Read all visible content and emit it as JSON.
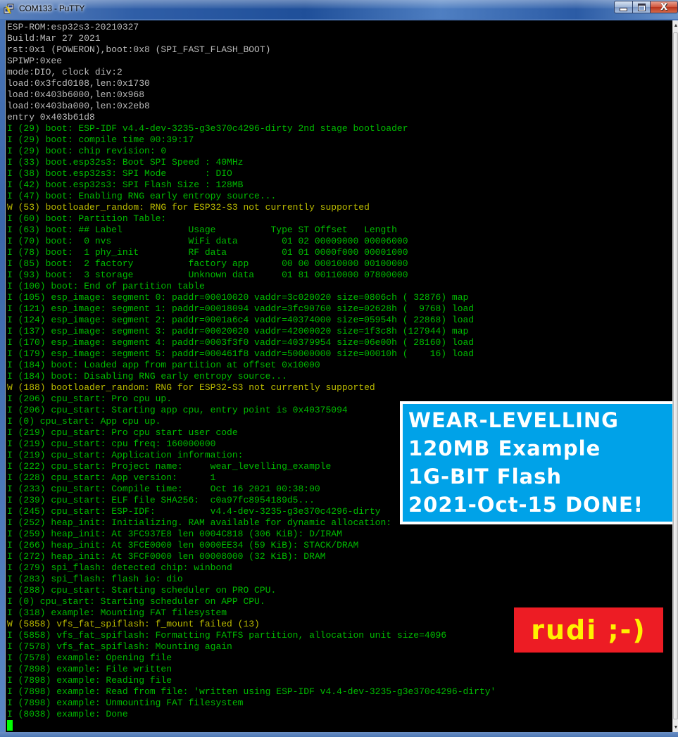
{
  "window": {
    "title": "COM133 - PuTTY",
    "app_icon": "putty-icon",
    "controls": {
      "minimize": "minimize-icon",
      "maximize": "maximize-icon",
      "close": "close-icon",
      "close_glyph": "X"
    }
  },
  "colors": {
    "terminal_bg": "#000000",
    "rom_text": "#bbbbbb",
    "info_text": "#00bb00",
    "warn_text": "#bbbb00",
    "cursor": "#00ff00",
    "banner_bg": "#00a2e8",
    "banner_border": "#ffffff",
    "signature_bg": "#ed1c24",
    "signature_text": "#fff200"
  },
  "terminal": {
    "lines": [
      {
        "level": "plain",
        "text": "ESP-ROM:esp32s3-20210327"
      },
      {
        "level": "plain",
        "text": "Build:Mar 27 2021"
      },
      {
        "level": "plain",
        "text": "rst:0x1 (POWERON),boot:0x8 (SPI_FAST_FLASH_BOOT)"
      },
      {
        "level": "plain",
        "text": "SPIWP:0xee"
      },
      {
        "level": "plain",
        "text": "mode:DIO, clock div:2"
      },
      {
        "level": "plain",
        "text": "load:0x3fcd0108,len:0x1730"
      },
      {
        "level": "plain",
        "text": "load:0x403b6000,len:0x968"
      },
      {
        "level": "plain",
        "text": "load:0x403ba000,len:0x2eb8"
      },
      {
        "level": "plain",
        "text": "entry 0x403b61d8"
      },
      {
        "level": "I",
        "text": "I (29) boot: ESP-IDF v4.4-dev-3235-g3e370c4296-dirty 2nd stage bootloader"
      },
      {
        "level": "I",
        "text": "I (29) boot: compile time 00:39:17"
      },
      {
        "level": "I",
        "text": "I (29) boot: chip revision: 0"
      },
      {
        "level": "I",
        "text": "I (33) boot.esp32s3: Boot SPI Speed : 40MHz"
      },
      {
        "level": "I",
        "text": "I (38) boot.esp32s3: SPI Mode       : DIO"
      },
      {
        "level": "I",
        "text": "I (42) boot.esp32s3: SPI Flash Size : 128MB"
      },
      {
        "level": "I",
        "text": "I (47) boot: Enabling RNG early entropy source..."
      },
      {
        "level": "W",
        "text": "W (53) bootloader_random: RNG for ESP32-S3 not currently supported"
      },
      {
        "level": "I",
        "text": "I (60) boot: Partition Table:"
      },
      {
        "level": "I",
        "text": "I (63) boot: ## Label            Usage          Type ST Offset   Length"
      },
      {
        "level": "I",
        "text": "I (70) boot:  0 nvs              WiFi data        01 02 00009000 00006000"
      },
      {
        "level": "I",
        "text": "I (78) boot:  1 phy_init         RF data          01 01 0000f000 00001000"
      },
      {
        "level": "I",
        "text": "I (85) boot:  2 factory          factory app      00 00 00010000 00100000"
      },
      {
        "level": "I",
        "text": "I (93) boot:  3 storage          Unknown data     01 81 00110000 07800000"
      },
      {
        "level": "I",
        "text": "I (100) boot: End of partition table"
      },
      {
        "level": "I",
        "text": "I (105) esp_image: segment 0: paddr=00010020 vaddr=3c020020 size=0806ch ( 32876) map"
      },
      {
        "level": "I",
        "text": "I (121) esp_image: segment 1: paddr=00018094 vaddr=3fc90760 size=02628h (  9768) load"
      },
      {
        "level": "I",
        "text": "I (124) esp_image: segment 2: paddr=0001a6c4 vaddr=40374000 size=05954h ( 22868) load"
      },
      {
        "level": "I",
        "text": "I (137) esp_image: segment 3: paddr=00020020 vaddr=42000020 size=1f3c8h (127944) map"
      },
      {
        "level": "I",
        "text": "I (170) esp_image: segment 4: paddr=0003f3f0 vaddr=40379954 size=06e00h ( 28160) load"
      },
      {
        "level": "I",
        "text": "I (179) esp_image: segment 5: paddr=000461f8 vaddr=50000000 size=00010h (    16) load"
      },
      {
        "level": "I",
        "text": "I (184) boot: Loaded app from partition at offset 0x10000"
      },
      {
        "level": "I",
        "text": "I (184) boot: Disabling RNG early entropy source..."
      },
      {
        "level": "W",
        "text": "W (188) bootloader_random: RNG for ESP32-S3 not currently supported"
      },
      {
        "level": "I",
        "text": "I (206) cpu_start: Pro cpu up."
      },
      {
        "level": "I",
        "text": "I (206) cpu_start: Starting app cpu, entry point is 0x40375094"
      },
      {
        "level": "I",
        "text": "I (0) cpu_start: App cpu up."
      },
      {
        "level": "I",
        "text": "I (219) cpu_start: Pro cpu start user code"
      },
      {
        "level": "I",
        "text": "I (219) cpu_start: cpu freq: 160000000"
      },
      {
        "level": "I",
        "text": "I (219) cpu_start: Application information:"
      },
      {
        "level": "I",
        "text": "I (222) cpu_start: Project name:     wear_levelling_example"
      },
      {
        "level": "I",
        "text": "I (228) cpu_start: App version:      1"
      },
      {
        "level": "I",
        "text": "I (233) cpu_start: Compile time:     Oct 16 2021 00:38:00"
      },
      {
        "level": "I",
        "text": "I (239) cpu_start: ELF file SHA256:  c0a97fc8954189d5..."
      },
      {
        "level": "I",
        "text": "I (245) cpu_start: ESP-IDF:          v4.4-dev-3235-g3e370c4296-dirty"
      },
      {
        "level": "I",
        "text": "I (252) heap_init: Initializing. RAM available for dynamic allocation:"
      },
      {
        "level": "I",
        "text": "I (259) heap_init: At 3FC937E8 len 0004C818 (306 KiB): D/IRAM"
      },
      {
        "level": "I",
        "text": "I (266) heap_init: At 3FCE0000 len 0000EE34 (59 KiB): STACK/DRAM"
      },
      {
        "level": "I",
        "text": "I (272) heap_init: At 3FCF0000 len 00008000 (32 KiB): DRAM"
      },
      {
        "level": "I",
        "text": "I (279) spi_flash: detected chip: winbond"
      },
      {
        "level": "I",
        "text": "I (283) spi_flash: flash io: dio"
      },
      {
        "level": "I",
        "text": "I (288) cpu_start: Starting scheduler on PRO CPU."
      },
      {
        "level": "I",
        "text": "I (0) cpu_start: Starting scheduler on APP CPU."
      },
      {
        "level": "I",
        "text": "I (318) example: Mounting FAT filesystem"
      },
      {
        "level": "W",
        "text": "W (5858) vfs_fat_spiflash: f_mount failed (13)"
      },
      {
        "level": "I",
        "text": "I (5858) vfs_fat_spiflash: Formatting FATFS partition, allocation unit size=4096"
      },
      {
        "level": "I",
        "text": "I (7578) vfs_fat_spiflash: Mounting again"
      },
      {
        "level": "I",
        "text": "I (7578) example: Opening file"
      },
      {
        "level": "I",
        "text": "I (7898) example: File written"
      },
      {
        "level": "I",
        "text": "I (7898) example: Reading file"
      },
      {
        "level": "I",
        "text": "I (7898) example: Read from file: 'written using ESP-IDF v4.4-dev-3235-g3e370c4296-dirty'"
      },
      {
        "level": "I",
        "text": "I (7898) example: Unmounting FAT filesystem"
      },
      {
        "level": "I",
        "text": "I (8038) example: Done"
      }
    ],
    "cursor": "block-cursor"
  },
  "banner": {
    "lines": [
      "WEAR-LEVELLING",
      "120MB Example",
      "1G-BIT Flash",
      "2021-Oct-15 DONE!"
    ]
  },
  "signature": {
    "text": "rudi ;-)"
  },
  "scrollbar": {
    "up_arrow": "▲",
    "down_arrow": "▼"
  }
}
